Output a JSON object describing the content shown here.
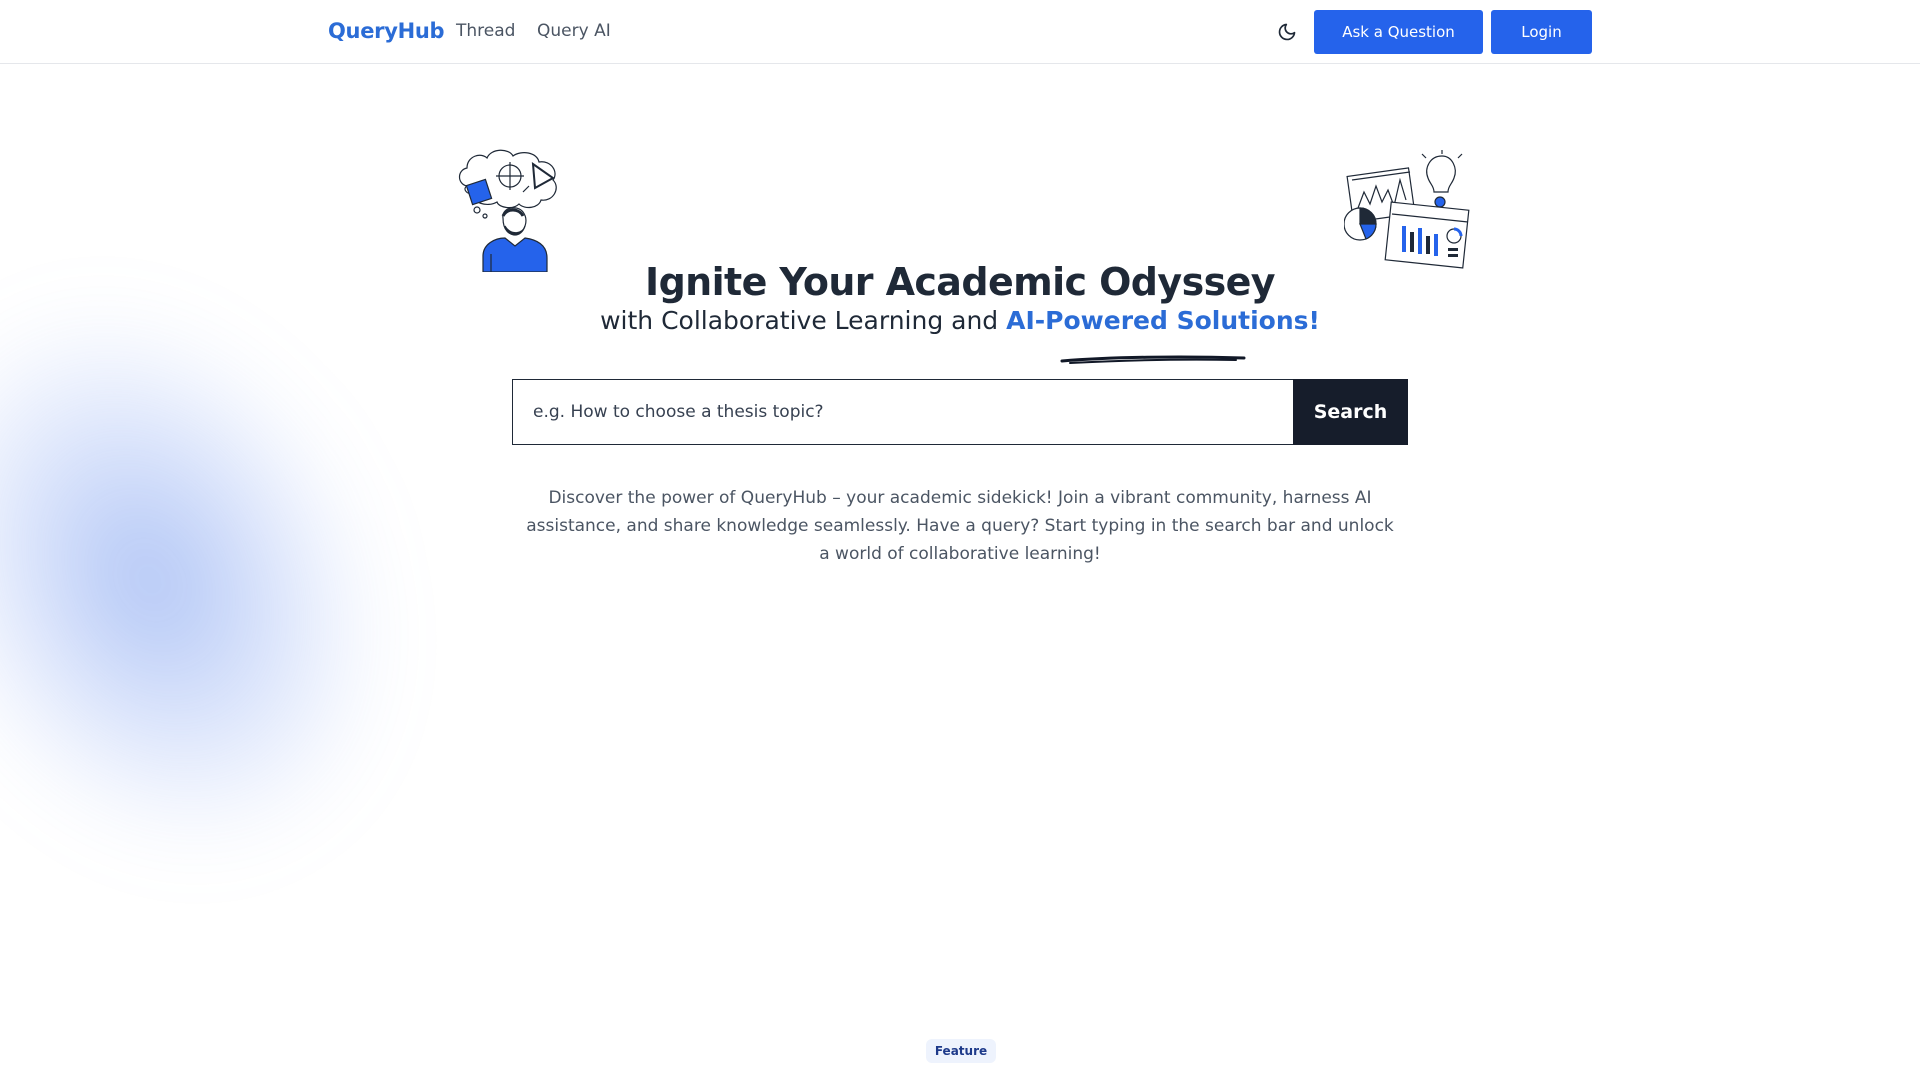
{
  "brand": "QueryHub",
  "nav": {
    "links": [
      "Thread",
      "Query AI"
    ],
    "theme_toggle_icon": "moon-icon",
    "ask_label": "Ask a Question",
    "login_label": "Login"
  },
  "hero": {
    "title": "Ignite Your Academic Odyssey",
    "subtitle_plain": "with Collaborative Learning and ",
    "subtitle_accent": "AI-Powered Solutions!",
    "description": "Discover the power of QueryHub – your academic sidekick! Join a vibrant community, harness AI assistance, and share knowledge seamlessly. Have a query? Start typing in the search bar and unlock a world of collaborative learning!"
  },
  "search": {
    "placeholder": "e.g. How to choose a thesis topic?",
    "value": "",
    "button_label": "Search"
  },
  "section_badge": "Feature",
  "colors": {
    "accent": "#2b6cd6",
    "primary_button": "#2563eb",
    "search_button": "#161d2b",
    "text_dark": "#1f2937"
  }
}
